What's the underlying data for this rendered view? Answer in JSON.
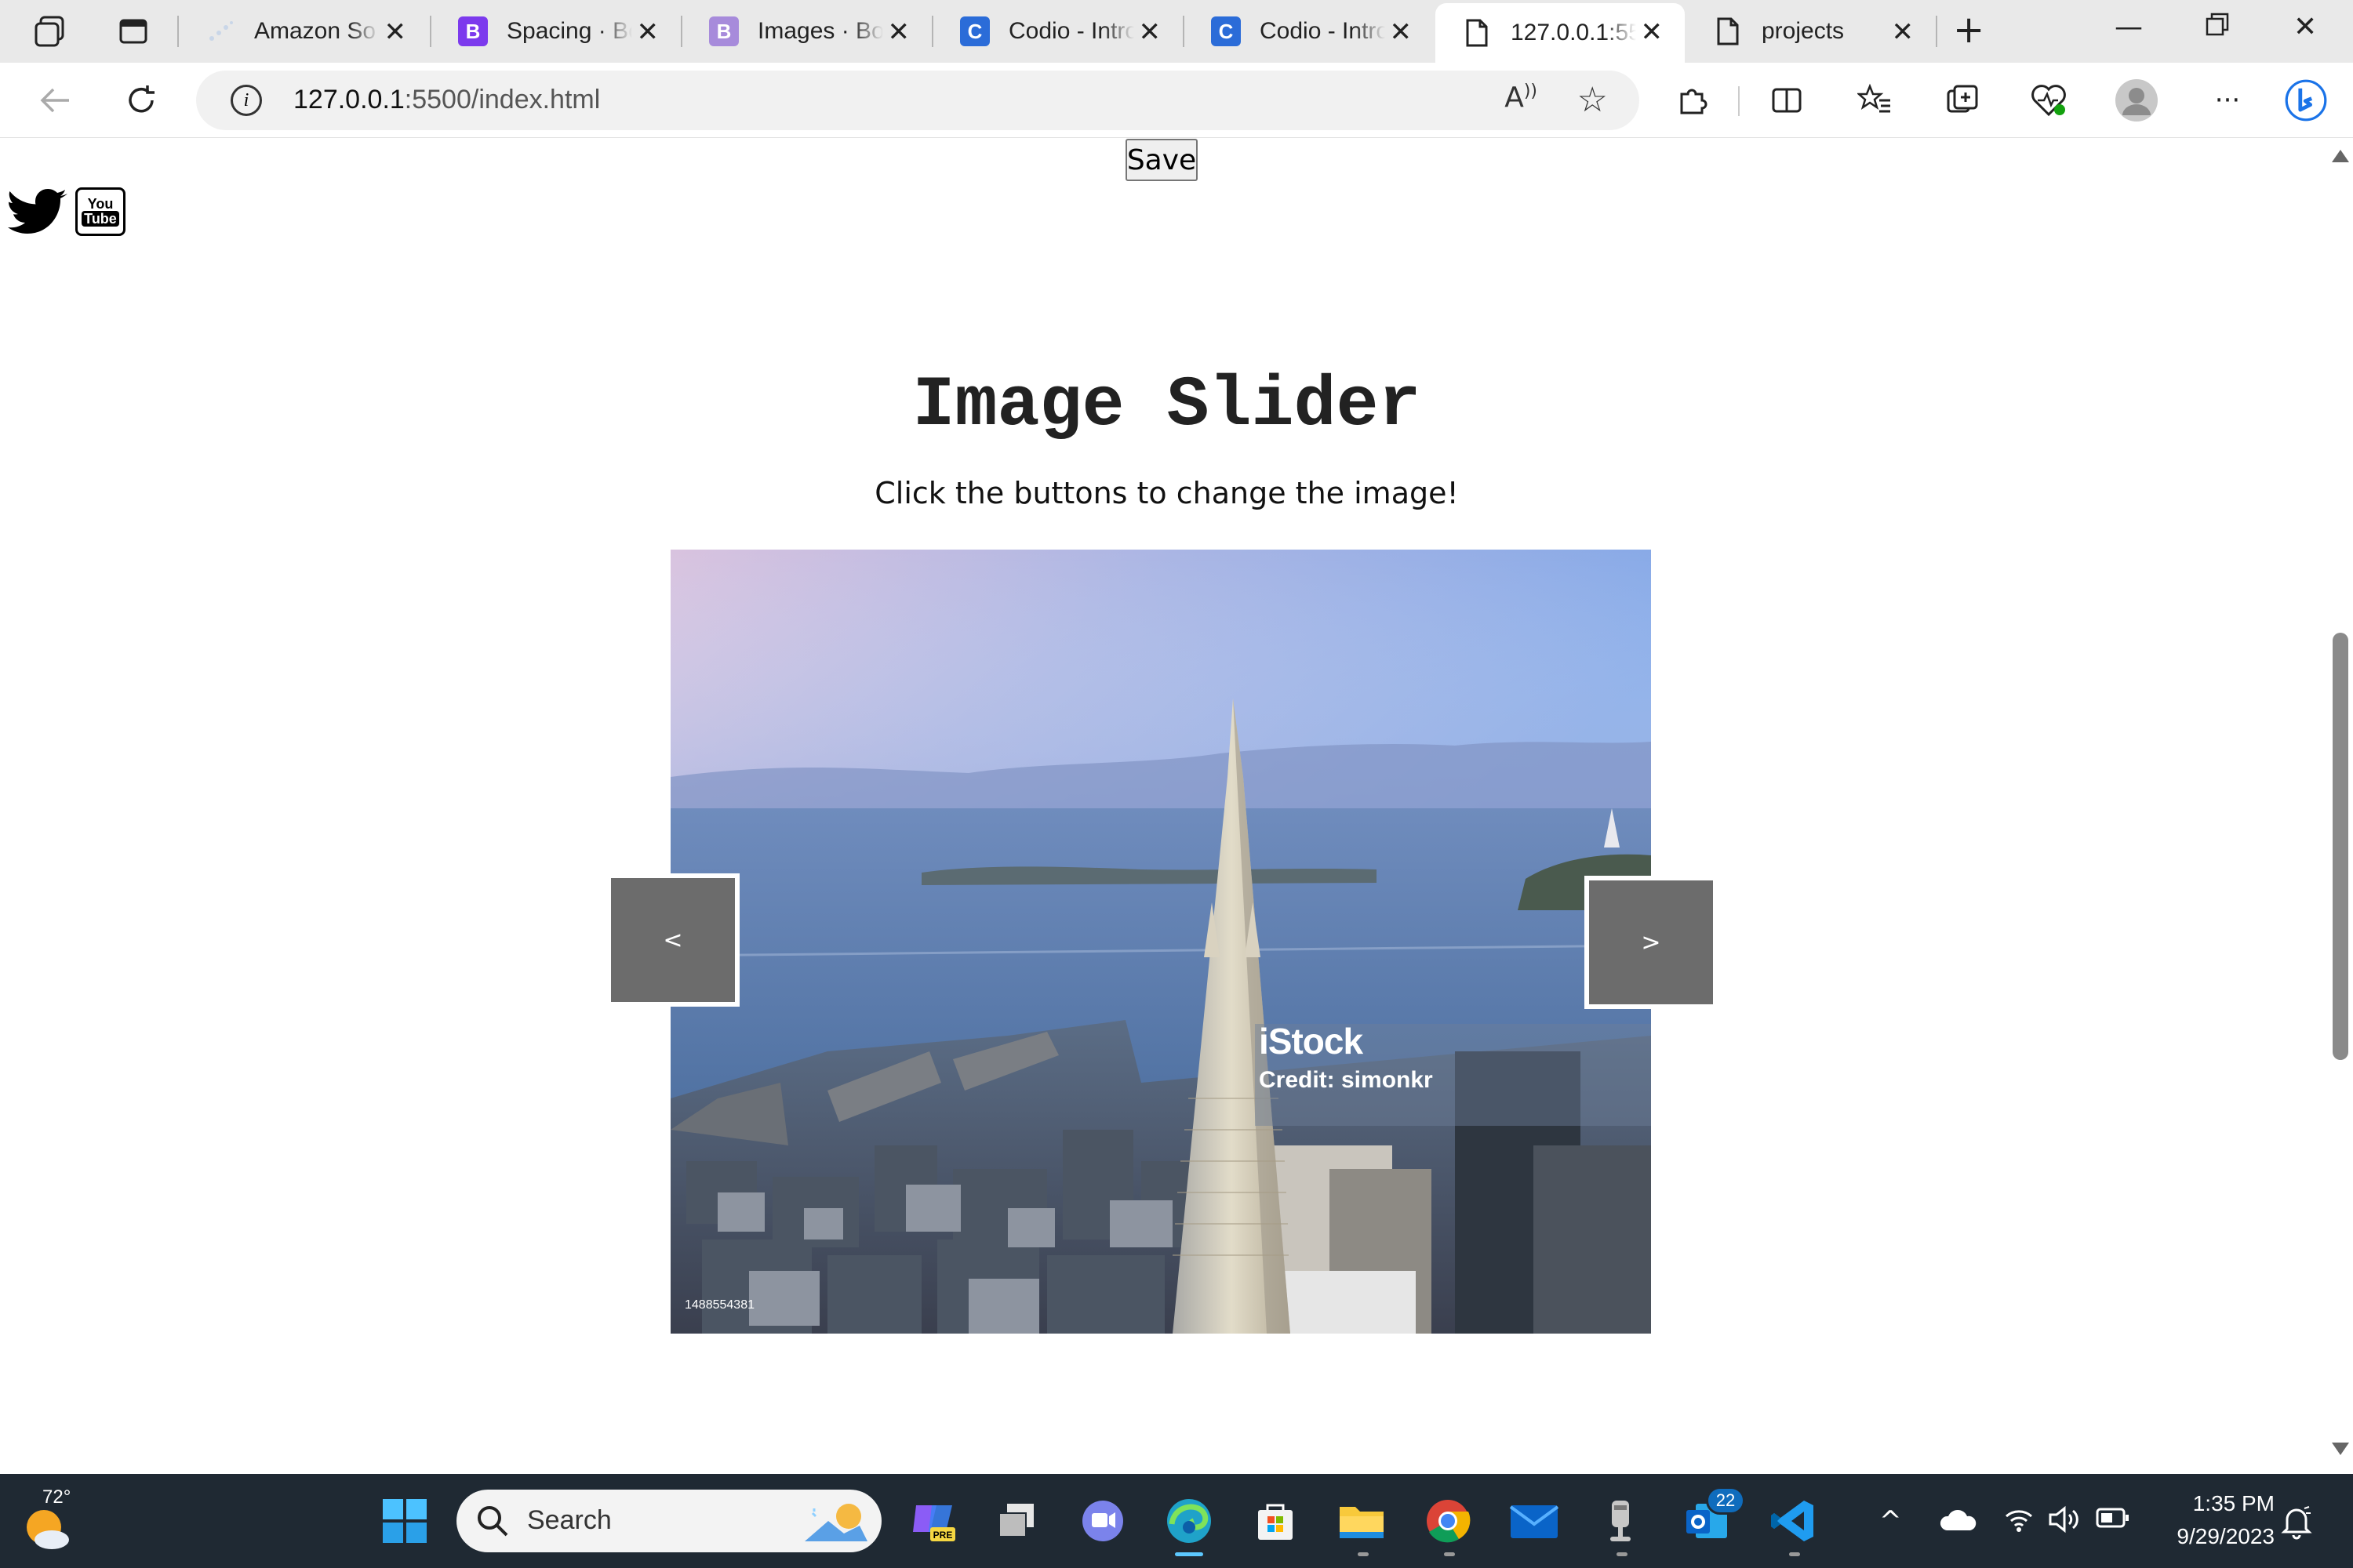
{
  "browser": {
    "tabs": [
      {
        "title": "Amazon So",
        "favicon": "amazon-dots-icon",
        "color": "#c9d6e8"
      },
      {
        "title": "Spacing · Bo",
        "favicon": "bootstrap-icon",
        "color": "#7c3aed",
        "glyph": "B"
      },
      {
        "title": "Images · Bo",
        "favicon": "bootstrap-icon",
        "color": "#a78bdb",
        "glyph": "B"
      },
      {
        "title": "Codio - Intro",
        "favicon": "codio-icon",
        "color": "#2b6cd8",
        "glyph": "C"
      },
      {
        "title": "Codio - Intro",
        "favicon": "codio-icon",
        "color": "#2b6cd8",
        "glyph": "C"
      },
      {
        "title": "127.0.0.1:55",
        "favicon": "page-icon",
        "active": true
      },
      {
        "title": "projects",
        "favicon": "page-icon"
      }
    ],
    "address": {
      "host": "127.0.0.1",
      "path": ":5500/index.html"
    }
  },
  "page": {
    "save_label": "Save",
    "heading": "Image Slider",
    "subheading": "Click the buttons to change the image!",
    "prev_label": "<",
    "next_label": ">",
    "image_watermark": "iStock",
    "image_credit": "Credit: simonkr",
    "image_stock_id": "1488554381"
  },
  "taskbar": {
    "weather_temp": "72°",
    "search_placeholder": "Search",
    "mail_badge": "22",
    "time": "1:35 PM",
    "date": "9/29/2023"
  },
  "colors": {
    "nav_button": "#6c6c6c",
    "taskbar": "#1f2933",
    "accent": "#0f6cbd"
  }
}
